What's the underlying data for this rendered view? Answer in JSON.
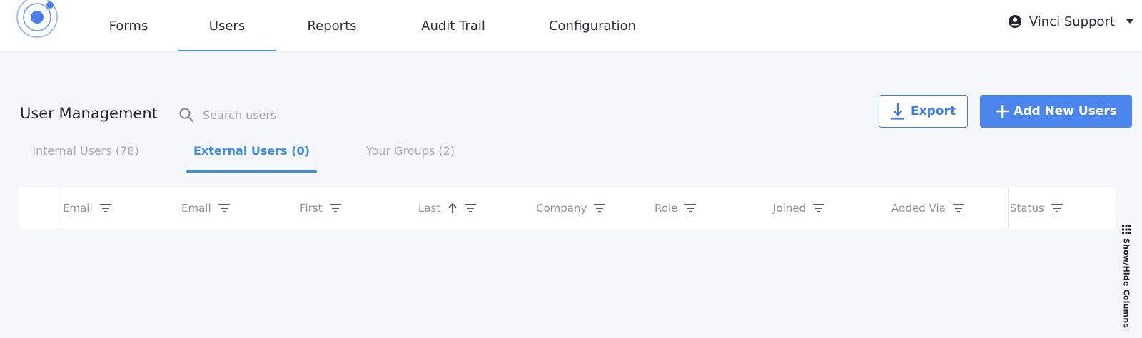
{
  "nav": {
    "items": [
      {
        "label": "Forms"
      },
      {
        "label": "Users"
      },
      {
        "label": "Reports"
      },
      {
        "label": "Audit Trail"
      },
      {
        "label": "Configuration"
      }
    ],
    "active": "Users",
    "user_name": "Vinci Support"
  },
  "page": {
    "title": "User Management",
    "search_placeholder": "Search users",
    "export_label": "Export",
    "add_label": "Add New Users"
  },
  "tabs": [
    {
      "label": "Internal Users (78)",
      "active": false
    },
    {
      "label": "External Users (0)",
      "active": true
    },
    {
      "label": "Your Groups (2)",
      "active": false
    }
  ],
  "table": {
    "columns": [
      {
        "label": "Email",
        "sort": ""
      },
      {
        "label": "Email",
        "sort": ""
      },
      {
        "label": "First",
        "sort": ""
      },
      {
        "label": "Last",
        "sort": "ascending"
      },
      {
        "label": "Company",
        "sort": ""
      },
      {
        "label": "Role",
        "sort": ""
      },
      {
        "label": "Joined",
        "sort": ""
      },
      {
        "label": "Added Via",
        "sort": ""
      },
      {
        "label": "Status",
        "sort": ""
      }
    ],
    "rows": []
  },
  "showhide_label": "Show/Hide Columns",
  "colors": {
    "accent": "#3d8fe3",
    "button_primary": "#4b86ee",
    "background": "#f6f7fa"
  },
  "icons": {
    "logo": "orbit-logo",
    "user": "account-circle-icon",
    "search": "search-icon",
    "export": "download-icon",
    "add": "plus-icon",
    "filter": "filter-icon",
    "sort": "arrow-up-icon",
    "columns": "grid-dots-icon"
  }
}
